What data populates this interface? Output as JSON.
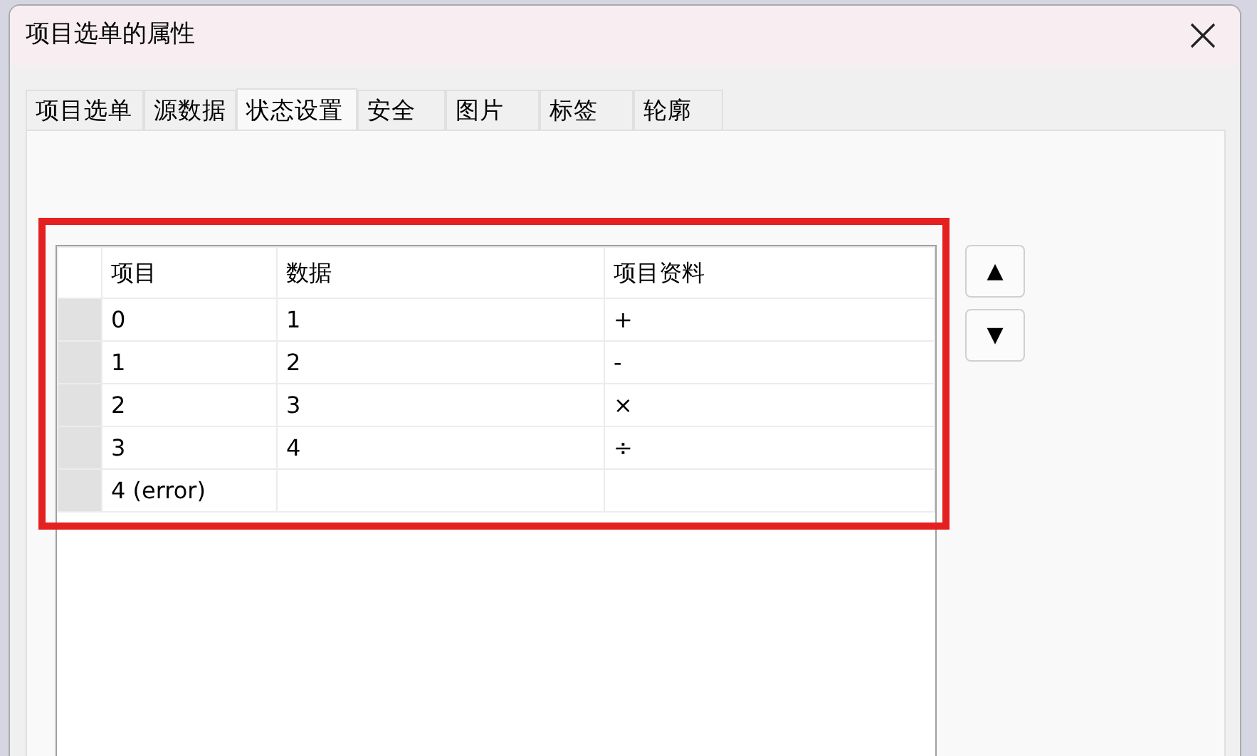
{
  "window": {
    "title": "项目选单的属性"
  },
  "tabs": [
    {
      "label": "项目选单",
      "selected": false
    },
    {
      "label": "源数据",
      "selected": false
    },
    {
      "label": "状态设置",
      "selected": true
    },
    {
      "label": "安全",
      "selected": false
    },
    {
      "label": "图片",
      "selected": false
    },
    {
      "label": "标签",
      "selected": false
    },
    {
      "label": "轮廓",
      "selected": false
    }
  ],
  "table": {
    "columns": [
      "项目",
      "数据",
      "项目资料"
    ],
    "rows": [
      {
        "cells": [
          "0",
          "1",
          "+"
        ]
      },
      {
        "cells": [
          "1",
          "2",
          "-"
        ]
      },
      {
        "cells": [
          "2",
          "3",
          "×"
        ]
      },
      {
        "cells": [
          "3",
          "4",
          "÷"
        ]
      },
      {
        "cells": [
          "4 (error)"
        ]
      }
    ]
  },
  "buttons": [
    {
      "label": "▲"
    },
    {
      "label": "▼"
    }
  ]
}
